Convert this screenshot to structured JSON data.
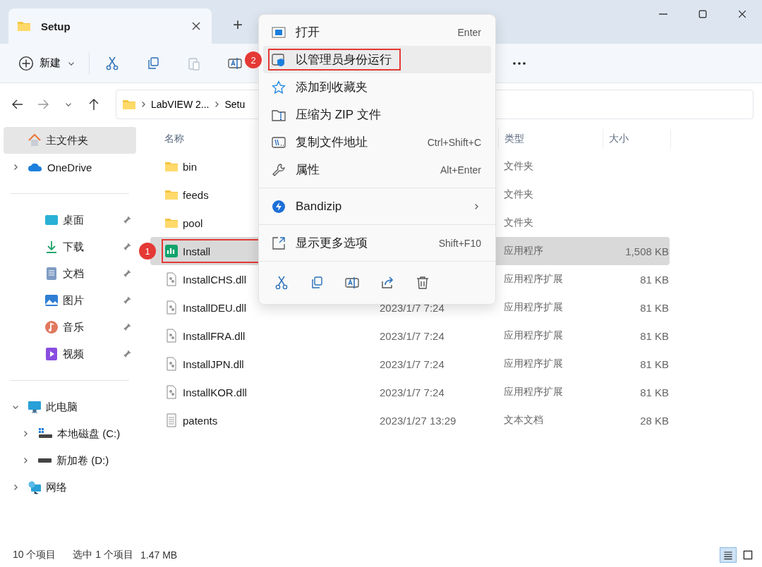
{
  "window": {
    "tab_title": "Setup",
    "new_tab": "+"
  },
  "toolbar": {
    "new_label": "新建",
    "buttons": [
      {
        "kind": "cut",
        "disabled": false
      },
      {
        "kind": "copy",
        "disabled": false
      },
      {
        "kind": "paste",
        "disabled": true
      },
      {
        "kind": "rename",
        "disabled": false
      }
    ]
  },
  "address": {
    "segments": [
      "LabVIEW 2...",
      "Setu"
    ]
  },
  "sidebar": {
    "sections": [
      [
        {
          "kind": "home",
          "label": "主文件夹",
          "selected": true
        },
        {
          "kind": "cloud",
          "label": "OneDrive",
          "selected": false,
          "expanded": false
        }
      ],
      [
        {
          "kind": "desktop",
          "label": "桌面",
          "selected": false,
          "pinned": true
        },
        {
          "kind": "download",
          "label": "下载",
          "selected": false,
          "pinned": true
        },
        {
          "kind": "document",
          "label": "文档",
          "selected": false,
          "pinned": true
        },
        {
          "kind": "pictures",
          "label": "图片",
          "selected": false,
          "pinned": true
        },
        {
          "kind": "music",
          "label": "音乐",
          "selected": false,
          "pinned": true
        },
        {
          "kind": "video",
          "label": "视频",
          "selected": false,
          "pinned": true
        }
      ],
      [
        {
          "kind": "computer",
          "label": "此电脑",
          "selected": false,
          "expanded": true,
          "children": [
            {
              "kind": "system-drive",
              "label": "本地磁盘 (C:)",
              "selected": false,
              "expanded": false
            },
            {
              "kind": "drive",
              "label": "新加卷 (D:)",
              "selected": false,
              "expanded": false
            }
          ]
        },
        {
          "kind": "network",
          "label": "网络",
          "selected": false,
          "expanded": false
        }
      ]
    ]
  },
  "table": {
    "columns": [
      {
        "label": "名称"
      },
      {
        "label": "类型"
      },
      {
        "label": "大小"
      }
    ],
    "rows": [
      {
        "kind": "folder",
        "name": "bin",
        "type": "文件夹",
        "selected": false
      },
      {
        "kind": "folder",
        "name": "feeds",
        "type": "文件夹",
        "selected": false
      },
      {
        "kind": "folder",
        "name": "pool",
        "type": "文件夹",
        "selected": false
      },
      {
        "kind": "app",
        "name": "Install",
        "type": "应用程序",
        "size": "1,508 KB",
        "selected": true,
        "annotation": "1"
      },
      {
        "kind": "dll",
        "name": "InstallCHS.dll",
        "type": "应用程序扩展",
        "size": "81 KB",
        "selected": false
      },
      {
        "kind": "dll",
        "name": "InstallDEU.dll",
        "date": "2023/1/7 7:24",
        "type": "应用程序扩展",
        "size": "81 KB",
        "selected": false
      },
      {
        "kind": "dll",
        "name": "InstallFRA.dll",
        "date": "2023/1/7 7:24",
        "type": "应用程序扩展",
        "size": "81 KB",
        "selected": false
      },
      {
        "kind": "dll",
        "name": "InstallJPN.dll",
        "date": "2023/1/7 7:24",
        "type": "应用程序扩展",
        "size": "81 KB",
        "selected": false
      },
      {
        "kind": "dll",
        "name": "InstallKOR.dll",
        "date": "2023/1/7 7:24",
        "type": "应用程序扩展",
        "size": "81 KB",
        "selected": false
      },
      {
        "kind": "text",
        "name": "patents",
        "date": "2023/1/27 13:29",
        "type": "文本文档",
        "size": "28 KB",
        "selected": false
      }
    ]
  },
  "context_menu": {
    "groups": [
      [
        {
          "kind": "open",
          "label": "打开",
          "shortcut": "Enter",
          "selected": false
        },
        {
          "kind": "admin",
          "label": "以管理员身份运行",
          "selected": true,
          "annotation": "2"
        },
        {
          "kind": "star",
          "label": "添加到收藏夹",
          "selected": false
        },
        {
          "kind": "zip",
          "label": "压缩为 ZIP 文件",
          "selected": false
        },
        {
          "kind": "path",
          "label": "复制文件地址",
          "shortcut": "Ctrl+Shift+C",
          "selected": false
        },
        {
          "kind": "wrench",
          "label": "属性",
          "shortcut": "Alt+Enter",
          "selected": false
        }
      ],
      [
        {
          "kind": "bandizip",
          "label": "Bandizip",
          "submenu": true,
          "selected": false
        }
      ],
      [
        {
          "kind": "more",
          "label": "显示更多选项",
          "shortcut": "Shift+F10",
          "selected": false
        }
      ]
    ]
  },
  "status_bar": {
    "count": "10 个项目",
    "selection": "选中 1 个项目",
    "size": "1.47 MB",
    "views": [
      {
        "kind": "details",
        "selected": true
      },
      {
        "kind": "tiles",
        "selected": false
      }
    ]
  }
}
